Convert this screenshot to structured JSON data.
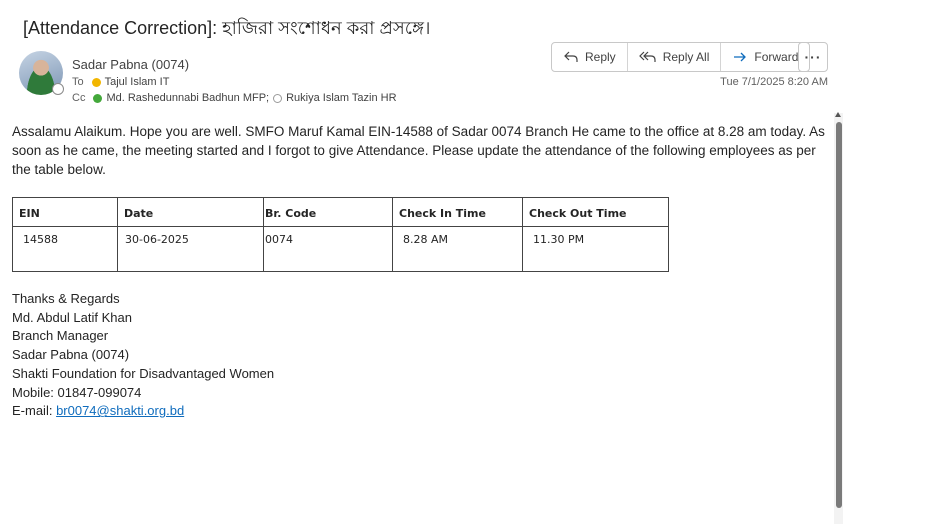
{
  "subject": "[Attendance Correction]: হাজিরা সংশোধন করা প্রসঙ্গে।",
  "sender": {
    "name": "Sadar Pabna (0074)"
  },
  "recipients": {
    "to_label": "To",
    "to": "Tajul Islam IT",
    "cc_label": "Cc",
    "cc": [
      "Md. Rashedunnabi Badhun MFP;",
      "Rukiya Islam Tazin HR"
    ]
  },
  "actions": {
    "reply": "Reply",
    "reply_all": "Reply All",
    "forward": "Forward",
    "more": "···"
  },
  "timestamp": "Tue 7/1/2025 8:20 AM",
  "body": "Assalamu Alaikum. Hope you are well. SMFO Maruf Kamal EIN-14588 of Sadar 0074 Branch He came to the office at 8.28 am today. As soon as he came, the meeting started and I forgot to give Attendance. Please update the attendance of the following employees as per the table below.",
  "table": {
    "headers": [
      "EIN",
      "Date",
      "Br. Code",
      "Check In Time",
      "Check Out Time"
    ],
    "rows": [
      [
        "14588",
        "30-06-2025",
        "0074",
        "8.28 AM",
        "11.30 PM"
      ]
    ]
  },
  "signature": {
    "line1": "Thanks & Regards",
    "line2": "Md. Abdul Latif Khan",
    "line3": "Branch Manager",
    "line4": "Sadar Pabna (0074)",
    "line5": "Shakti Foundation for Disadvantaged Women",
    "mobile": "Mobile: 01847-099074",
    "email_label": "E-mail: ",
    "email": "br0074@shakti.org.bd"
  },
  "colors": {
    "accent": "#0f6cbd",
    "presence_away": "#f2b600",
    "presence_available": "#44a83b"
  },
  "icons": {
    "reply": "reply-arrow-icon",
    "reply_all": "reply-all-icon",
    "forward": "forward-arrow-icon"
  }
}
